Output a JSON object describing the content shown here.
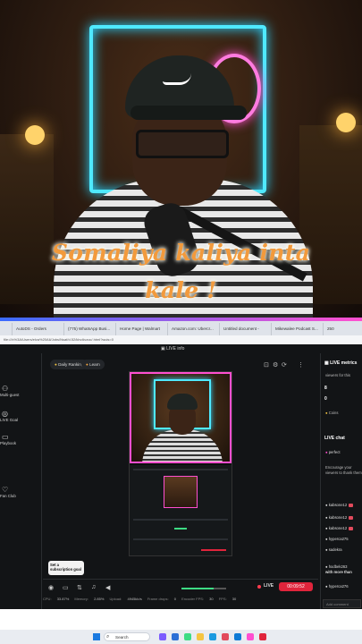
{
  "caption": {
    "line1": "Somaliya kaliya inta",
    "line2": "kale !"
  },
  "browser": {
    "tabs": [
      "",
      "AutoDS - Orders",
      "(775) WhatsApp Busi...",
      "Home Page | Walmart",
      "Amazon.com: Ubercr...",
      "Untitled document -",
      "Mikewalee Podcast S...",
      "250"
    ],
    "address": "file:///c%3A/Users/elva%20Ali/Jobs/Nsaf/d.52/kbvAvzoc/.html?wuis=0"
  },
  "app": {
    "title": "LIVE info",
    "left_sidebar": [
      "Multi-guest",
      "LIVE Goal",
      "Playbook",
      "Fan Club"
    ],
    "pills": [
      "Daily Ranking",
      "Learn"
    ],
    "notification": "Set a subscription goal",
    "right_sidebar": {
      "metrics_title": "LIVE metrics",
      "metric_label": "viewers for this",
      "metric_value": "8",
      "metric_value2": "0",
      "coins_label": "Coins",
      "chat_title": "LIVE chat",
      "pinned_user": "perfect",
      "chat_prompt": "Encourage your viewers to thank them",
      "users": [
        "kabsone12",
        "kabsone12",
        "kabsone12",
        "hyperca275",
        "sadekra",
        "hodbek263",
        "hyperca276"
      ],
      "chat_msg": "with more than",
      "chat_placeholder": "Add comment"
    },
    "controls": {
      "live_label": "LIVE",
      "timer": "00:09:52"
    },
    "stats": [
      {
        "label": "CPU:",
        "value": "33.87%"
      },
      {
        "label": "Memory:",
        "value": "2.85%"
      },
      {
        "label": "Upload:",
        "value": "4945kb/s"
      },
      {
        "label": "Frame drops:",
        "value": "0"
      },
      {
        "label": "Encoder FPS:",
        "value": "30"
      },
      {
        "label": "FPS:",
        "value": "30"
      }
    ]
  },
  "taskbar": {
    "search_placeholder": "Search"
  },
  "colors": {
    "accent_live": "#e0243b",
    "neon_cyan": "#4fe9ff",
    "neon_pink": "#ff4fd0",
    "caption": "#f29a3c"
  }
}
